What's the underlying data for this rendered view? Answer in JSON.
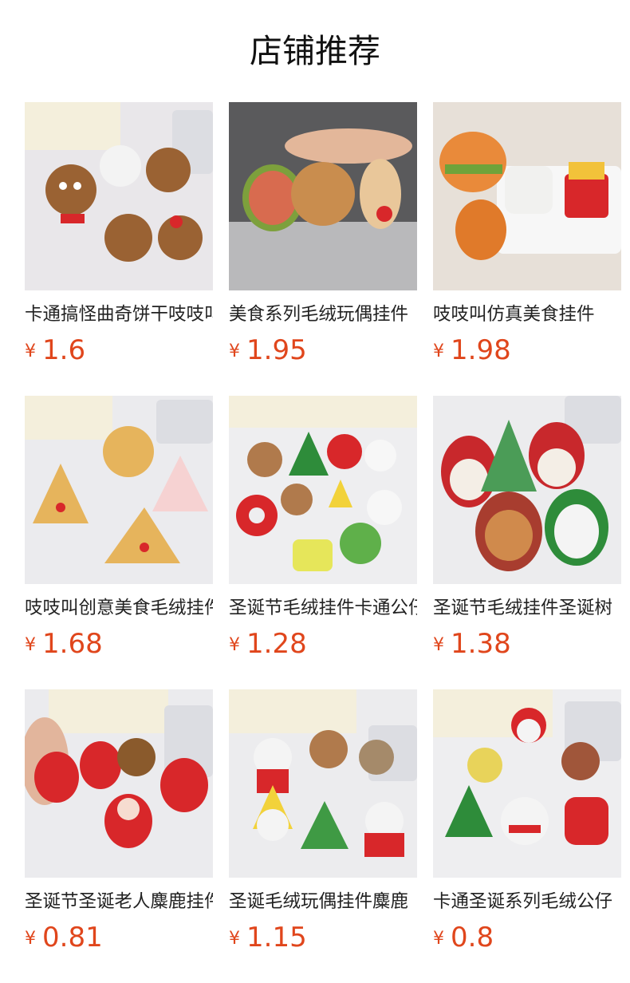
{
  "header": {
    "title": "店铺推荐"
  },
  "currency_symbol": "¥",
  "products": [
    {
      "name": "卡通搞怪曲奇饼干吱吱叫毛绒挂件",
      "price": "1.6",
      "image_icon": "cookie-plush-keychains-image"
    },
    {
      "name": "美食系列毛绒玩偶挂件",
      "price": "1.95",
      "image_icon": "food-plush-keychains-image"
    },
    {
      "name": "吱吱叫仿真美食挂件",
      "price": "1.98",
      "image_icon": "fastfood-plush-image"
    },
    {
      "name": "吱吱叫创意美食毛绒挂件",
      "price": "1.68",
      "image_icon": "pizza-plush-image"
    },
    {
      "name": "圣诞节毛绒挂件卡通公仔",
      "price": "1.28",
      "image_icon": "christmas-plush-set-image"
    },
    {
      "name": "圣诞节毛绒挂件圣诞树",
      "price": "1.38",
      "image_icon": "christmas-patch-plush-image"
    },
    {
      "name": "圣诞节圣诞老人麋鹿挂件",
      "price": "0.81",
      "image_icon": "santa-reindeer-plush-image"
    },
    {
      "name": "圣诞毛绒玩偶挂件麋鹿",
      "price": "1.15",
      "image_icon": "christmas-kitty-plush-image"
    },
    {
      "name": "卡通圣诞系列毛绒公仔",
      "price": "0.8",
      "image_icon": "christmas-series-plush-image"
    }
  ]
}
